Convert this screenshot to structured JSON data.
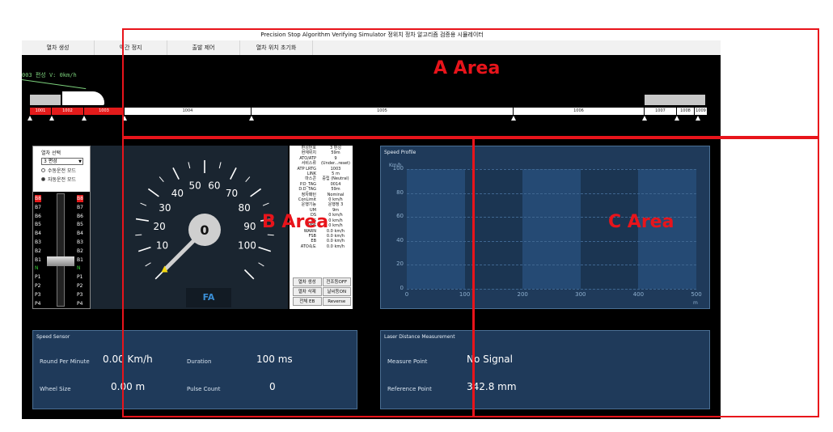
{
  "app_title": "Precision Stop Algorithm Verifying Simulator 정위치 정차 알고리즘 검증용 시뮬레이터",
  "menu": [
    "열차 생성",
    "역간 정지",
    "출발 제어",
    "열차 위치 초기화"
  ],
  "track": {
    "speed_readout": "003 편성 V: 0km/h",
    "segments": [
      "1001",
      "1002",
      "1003",
      "1004",
      "1005",
      "1006",
      "1007",
      "1008",
      "1009"
    ]
  },
  "control": {
    "title": "열차 선택",
    "selected": "3 편성",
    "manual_mode": "수동운전 모드",
    "auto_mode": "자동운전 모드",
    "notches_left": [
      "B8",
      "B7",
      "B6",
      "B5",
      "B4",
      "B3",
      "B2",
      "B1",
      "N",
      "P1",
      "P2",
      "P3",
      "P4"
    ],
    "notches_right": [
      "B8",
      "B7",
      "B6",
      "B5",
      "B4",
      "B3",
      "B2",
      "B1",
      "N",
      "P1",
      "P2",
      "P3",
      "P4"
    ]
  },
  "gauge": {
    "speed_value": "0",
    "speed_numeric": 0,
    "labels": [
      "10",
      "20",
      "30",
      "40",
      "50",
      "60",
      "70",
      "80",
      "90",
      "100"
    ],
    "mode": "FA"
  },
  "info": {
    "rows": [
      {
        "k": "편성번호",
        "v": "3 편성"
      },
      {
        "k": "현재위치",
        "v": "59m"
      },
      {
        "k": "ATO/ATP",
        "v": "9"
      },
      {
        "k": "서비스류",
        "v": "(Under...reset)"
      },
      {
        "k": "ATP LRTG",
        "v": "1003"
      },
      {
        "k": "LINK",
        "v": "5 m"
      },
      {
        "k": "마스콘",
        "v": "중립 (Neutral)"
      },
      {
        "k": "P.D_TAG",
        "v": "0014"
      },
      {
        "k": "D.D_TAG",
        "v": "59m"
      },
      {
        "k": "정차패턴",
        "v": "Nominal"
      },
      {
        "k": "ConLimit",
        "v": "0 km/h"
      },
      {
        "k": "운행기능",
        "v": "운행정 3"
      },
      {
        "k": "UM",
        "v": "9m"
      },
      {
        "k": "DS",
        "v": "0 km/h"
      },
      {
        "k": "ES",
        "v": "0 km/h"
      },
      {
        "k": "MPS",
        "v": "0 km/h"
      },
      {
        "k": "WARN",
        "v": "0.0 km/h"
      },
      {
        "k": "FSB",
        "v": "0.0 km/h"
      },
      {
        "k": "EB",
        "v": "0.0 km/h"
      },
      {
        "k": "ATO속도",
        "v": "0.0 km/h"
      }
    ],
    "buttons": [
      "열차 생성",
      "전조등OFF",
      "열차 삭제",
      "날씨등ON",
      "전체 EB",
      "Reverse"
    ]
  },
  "speed_profile": {
    "title": "Speed Profile",
    "unit": "Km/h",
    "xunit": "m"
  },
  "chart_data": {
    "type": "line",
    "title": "Speed Profile",
    "ylabel": "Km/h",
    "xlabel": "m",
    "x_ticks": [
      0,
      100,
      200,
      300,
      400,
      500
    ],
    "y_ticks": [
      0,
      20,
      40,
      60,
      80,
      100
    ],
    "xlim": [
      0,
      500
    ],
    "ylim": [
      0,
      100
    ],
    "shaded_bands": [
      [
        100,
        200
      ],
      [
        300,
        400
      ]
    ],
    "series": []
  },
  "speed_sensor": {
    "title": "Speed Sensor",
    "rpm_label": "Round Per Minute",
    "rpm_value": "0.00 Km/h",
    "duration_label": "Duration",
    "duration_value": "100 ms",
    "wheel_label": "Wheel Size",
    "wheel_value": "0.00 m",
    "pulse_label": "Pulse Count",
    "pulse_value": "0"
  },
  "laser": {
    "title": "Laser Distance Measurement",
    "measure_label": "Measure Point",
    "measure_value": "No Signal",
    "reference_label": "Reference Point",
    "reference_value": "342.8 mm"
  },
  "overlays": {
    "a_label": "A  Area",
    "b_label": "B  Area",
    "c_label": "C  Area",
    "color": "#e8141b"
  }
}
